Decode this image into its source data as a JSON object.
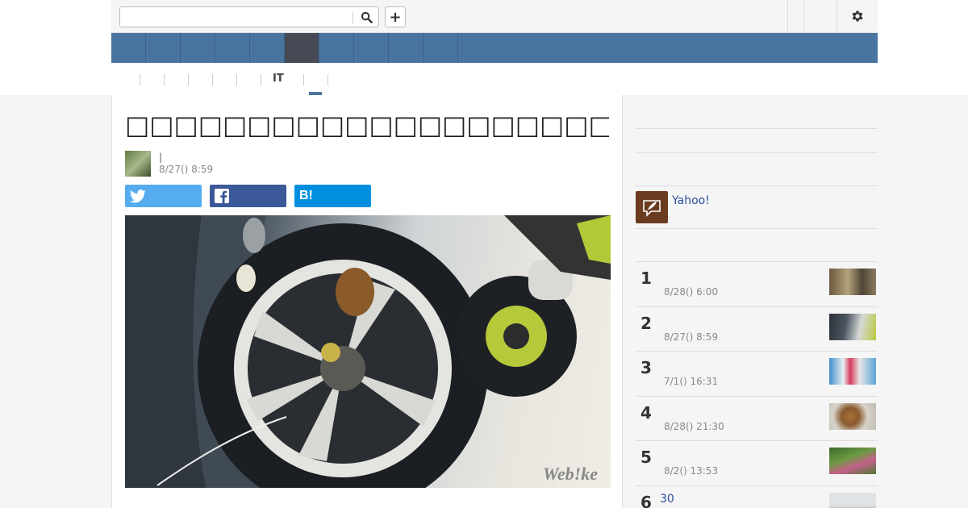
{
  "search": {
    "value": "",
    "placeholder": ""
  },
  "header": {
    "plus_label": "+",
    "nav_items": [
      "",
      "",
      "",
      "",
      "",
      "",
      "",
      "",
      "",
      ""
    ]
  },
  "subnav": {
    "items": [
      "",
      "",
      "",
      "",
      "",
      "IT",
      ""
    ]
  },
  "article": {
    "title": "□□□□□□□□□□□□□□□□□□□□□□□□□□□□□□□□□□□",
    "author": "|",
    "date": "8/27() 8:59",
    "share": {
      "twitter": "",
      "facebook": "",
      "hatena": "B!"
    },
    "watermark": "Web!ke"
  },
  "sidebar": {
    "promo_text": "Yahoo!",
    "ranking": [
      {
        "num": "1",
        "title": "",
        "date": "8/28() 6:00"
      },
      {
        "num": "2",
        "title": "",
        "date": "8/27() 8:59"
      },
      {
        "num": "3",
        "title": "",
        "date": "7/1() 16:31"
      },
      {
        "num": "4",
        "title": "",
        "date": "8/28() 21:30"
      },
      {
        "num": "5",
        "title": "",
        "date": "8/2() 13:53"
      },
      {
        "num": "6",
        "title": "30",
        "date": ""
      }
    ]
  },
  "colors": {
    "nav": "#4a74a0",
    "nav_active": "#464a55",
    "twitter": "#55acee",
    "facebook": "#3b5998",
    "hatena": "#008fde",
    "link": "#2b4f9c"
  },
  "icons": [
    "search-icon",
    "gear-icon",
    "twitter-icon",
    "facebook-icon",
    "quill-icon"
  ]
}
